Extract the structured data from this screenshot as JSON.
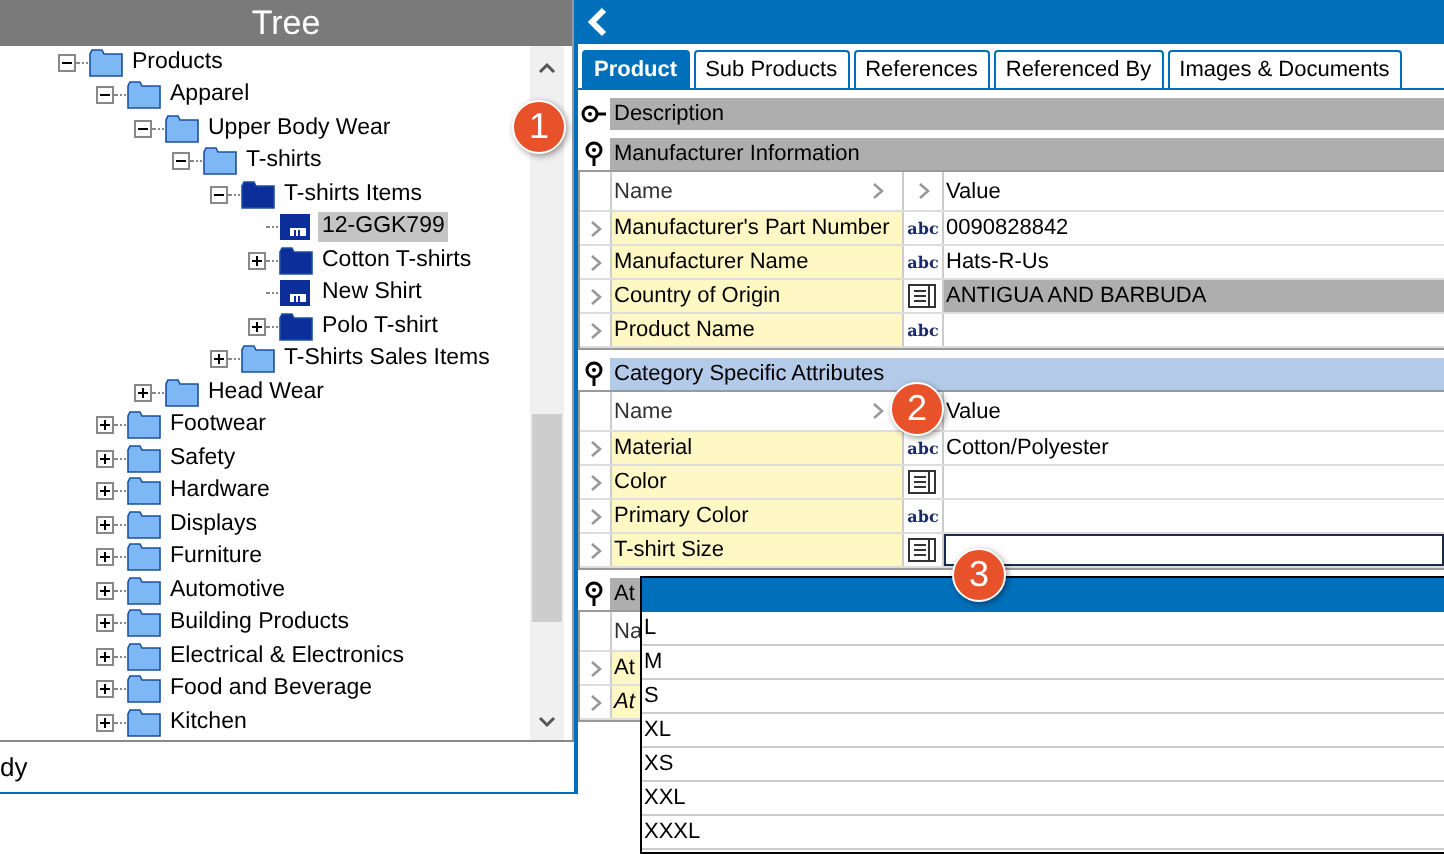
{
  "tree_panel": {
    "title": "Tree"
  },
  "tree": [
    {
      "label": "Products",
      "kind": "folder",
      "expanded": true,
      "selected": false,
      "children": [
        {
          "label": "Apparel",
          "kind": "folder",
          "expanded": true,
          "selected": false,
          "children": [
            {
              "label": "Upper Body Wear",
              "kind": "folder",
              "expanded": true,
              "selected": false,
              "children": [
                {
                  "label": "T-shirts",
                  "kind": "folder",
                  "expanded": true,
                  "selected": false,
                  "children": [
                    {
                      "label": "T-shirts Items",
                      "kind": "dark-folder",
                      "expanded": true,
                      "selected": false,
                      "children": [
                        {
                          "label": "12-GGK799",
                          "kind": "item",
                          "selected": true
                        },
                        {
                          "label": "Cotton T-shirts",
                          "kind": "dark-folder",
                          "expanded": false,
                          "selected": false
                        },
                        {
                          "label": "New Shirt",
                          "kind": "item",
                          "selected": false
                        },
                        {
                          "label": "Polo T-shirt",
                          "kind": "dark-folder",
                          "expanded": false,
                          "selected": false
                        }
                      ]
                    },
                    {
                      "label": "T-Shirts Sales Items",
                      "kind": "folder",
                      "expanded": false,
                      "selected": false
                    }
                  ]
                }
              ]
            },
            {
              "label": "Head Wear",
              "kind": "folder",
              "expanded": false,
              "selected": false
            }
          ]
        },
        {
          "label": "Footwear",
          "kind": "folder",
          "expanded": false,
          "selected": false
        },
        {
          "label": "Safety",
          "kind": "folder",
          "expanded": false,
          "selected": false
        },
        {
          "label": "Hardware",
          "kind": "folder",
          "expanded": false,
          "selected": false
        },
        {
          "label": "Displays",
          "kind": "folder",
          "expanded": false,
          "selected": false
        },
        {
          "label": "Furniture",
          "kind": "folder",
          "expanded": false,
          "selected": false
        },
        {
          "label": "Automotive",
          "kind": "folder",
          "expanded": false,
          "selected": false
        },
        {
          "label": "Building Products",
          "kind": "folder",
          "expanded": false,
          "selected": false
        },
        {
          "label": "Electrical & Electronics",
          "kind": "folder",
          "expanded": false,
          "selected": false
        },
        {
          "label": "Food and Beverage",
          "kind": "folder",
          "expanded": false,
          "selected": false
        },
        {
          "label": "Kitchen",
          "kind": "folder",
          "expanded": false,
          "selected": false
        }
      ]
    }
  ],
  "status_bar": {
    "text": "dy"
  },
  "tabs": [
    {
      "label": "Product",
      "selected": true
    },
    {
      "label": "Sub Products",
      "selected": false
    },
    {
      "label": "References",
      "selected": false
    },
    {
      "label": "Referenced By",
      "selected": false
    },
    {
      "label": "Images & Documents",
      "selected": false
    }
  ],
  "sections": [
    {
      "title": "Description",
      "expanded": false,
      "selected": false
    },
    {
      "title": "Manufacturer Information",
      "expanded": true,
      "selected": false,
      "icon_column_chevron": true,
      "columns": [
        "Name",
        "Value"
      ],
      "rows": [
        {
          "name": "Manufacturer's Part Number",
          "kind": "text",
          "type_label": "abc",
          "value": "0090828842",
          "highlighted": false
        },
        {
          "name": "Manufacturer Name",
          "kind": "text",
          "type_label": "abc",
          "value": "Hats-R-Us",
          "highlighted": false
        },
        {
          "name": "Country of Origin",
          "kind": "list",
          "value": "ANTIGUA AND BARBUDA",
          "highlighted": true
        },
        {
          "name": "Product Name",
          "kind": "text",
          "type_label": "abc",
          "highlighted": false
        }
      ]
    },
    {
      "title": "Category Specific Attributes",
      "expanded": true,
      "selected": true,
      "icon_column_chevron": false,
      "columns": [
        "Name",
        "Value"
      ],
      "rows": [
        {
          "name": "Material",
          "kind": "text",
          "type_label": "abc",
          "value": "Cotton/Polyester",
          "highlighted": false
        },
        {
          "name": "Color",
          "kind": "list",
          "highlighted": false
        },
        {
          "name": "Primary Color",
          "kind": "text",
          "type_label": "abc",
          "highlighted": false
        },
        {
          "name": "T-shirt Size",
          "kind": "list",
          "highlighted": false,
          "editing": true
        }
      ]
    },
    {
      "title": "At",
      "expanded": true,
      "selected": false,
      "columns": [
        "Na"
      ],
      "rows": [
        {
          "name": "At",
          "kind": "none",
          "italic": false,
          "highlighted": false
        },
        {
          "name": "At",
          "kind": "none",
          "italic": true,
          "highlighted": false
        }
      ]
    }
  ],
  "dropdown": {
    "options": [
      "L",
      "M",
      "S",
      "XL",
      "XS",
      "XXL",
      "XXXL"
    ]
  },
  "callouts": [
    "1",
    "2",
    "3"
  ]
}
